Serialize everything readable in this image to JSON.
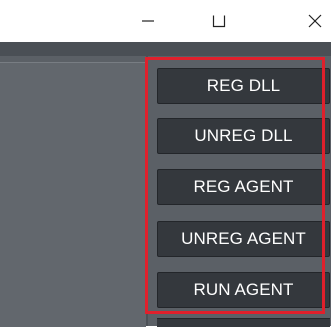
{
  "titlebar": {
    "minimize_icon": "minimize-icon",
    "maximize_icon": "maximize-icon",
    "close_icon": "close-icon"
  },
  "buttons": [
    {
      "label": "REG DLL"
    },
    {
      "label": "UNREG DLL"
    },
    {
      "label": "REG AGENT"
    },
    {
      "label": "UNREG AGENT"
    },
    {
      "label": "RUN AGENT"
    }
  ],
  "colors": {
    "highlight": "#e0202c",
    "button_bg": "#34383d",
    "panel_bg": "#5b6066"
  }
}
